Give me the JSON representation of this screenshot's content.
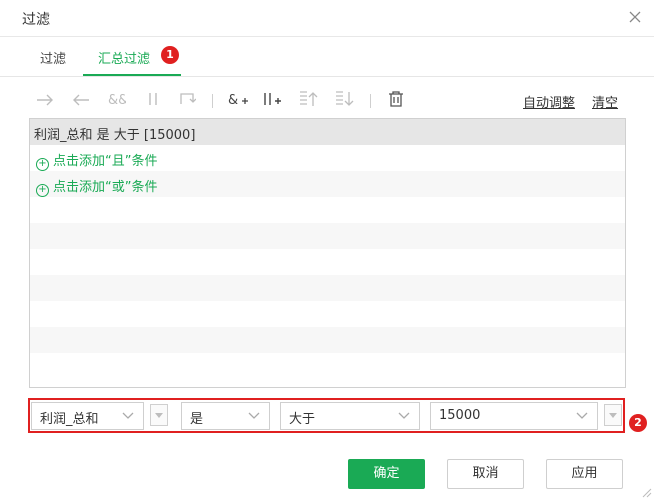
{
  "dialog": {
    "title": "过滤"
  },
  "tabs": [
    {
      "label": "过滤"
    },
    {
      "label": "汇总过滤"
    }
  ],
  "badges": {
    "tab_badge": "1",
    "condition_badge": "2"
  },
  "toolbar": {
    "icons": [
      "arrow-right-icon",
      "arrow-left-icon",
      "and-icon",
      "or-icon",
      "swap-icon",
      "add-and-icon",
      "add-or-icon",
      "move-up-icon",
      "move-down-icon",
      "delete-icon"
    ],
    "auto_adjust": "自动调整",
    "clear": "清空"
  },
  "conditions": {
    "selected": "利润_总和 是 大于 [15000]",
    "add_and": "点击添加“且”条件",
    "add_or": "点击添加“或”条件"
  },
  "editor": {
    "field": "利润_总和",
    "operator": "是",
    "comparison": "大于",
    "value": "15000"
  },
  "buttons": {
    "ok": "确定",
    "cancel": "取消",
    "apply": "应用"
  },
  "colors": {
    "accent": "#1aaa55",
    "highlight": "#e02020"
  }
}
